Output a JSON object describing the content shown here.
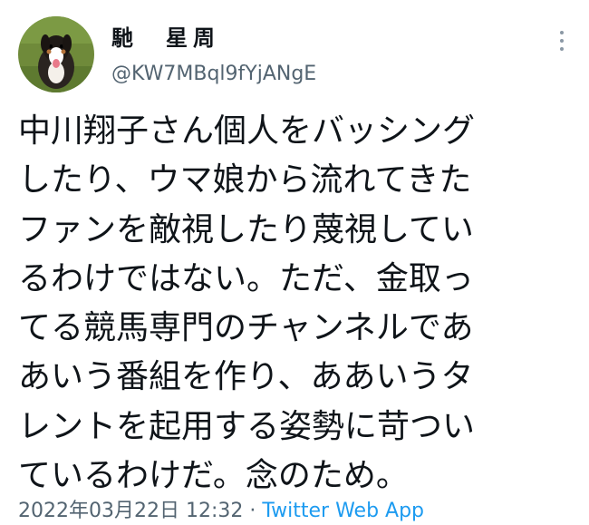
{
  "author": {
    "name": "馳　星周",
    "handle": "@KW7MBql9fYjANgE"
  },
  "tweet": {
    "lines": [
      "中川翔子さん個人をバッシング",
      "したり、ウマ娘から流れてきた",
      "ファンを敵視したり蔑視してい",
      "るわけではない。ただ、金取っ",
      "てる競馬専門のチャンネルであ",
      "あいう番組を作り、ああいうタ",
      "レントを起用する姿勢に苛つい",
      "ているわけだ。念のため。"
    ]
  },
  "meta": {
    "timestamp": "2022年03月22日 12:32",
    "separator": " · ",
    "source": "Twitter Web App"
  },
  "icons": {
    "menu": "more-icon",
    "avatar": "dog-avatar"
  },
  "colors": {
    "text": "#0f1419",
    "secondary": "#536471",
    "link": "#1d9bf0"
  }
}
